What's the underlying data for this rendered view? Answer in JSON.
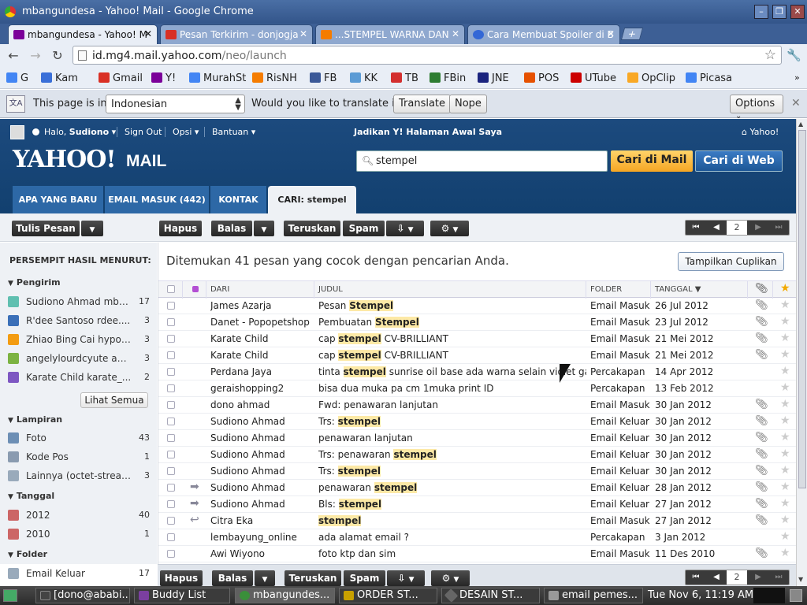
{
  "window": {
    "title": "mbangundesa - Yahoo! Mail - Google Chrome"
  },
  "tabs": [
    {
      "label": "mbangundesa - Yahoo! M",
      "color": "#7b0099",
      "active": true
    },
    {
      "label": "Pesan Terkirim - donjogja",
      "color": "#d93025"
    },
    {
      "label": "...STEMPEL WARNA DAN",
      "color": "#f57c00"
    },
    {
      "label": "Cara Membuat Spoiler di B",
      "color": "#3367d6"
    }
  ],
  "omnibox": {
    "host": "id.mg4.mail.yahoo.com",
    "path": "/neo/launch"
  },
  "bookmarks": [
    {
      "label": "G",
      "color": "#4285f4"
    },
    {
      "label": "Kam",
      "color": "#3a6fd8"
    },
    {
      "label": "Gmail",
      "color": "#d93025"
    },
    {
      "label": "Y!",
      "color": "#7b0099"
    },
    {
      "label": "MurahSt",
      "color": "#4285f4"
    },
    {
      "label": "RisNH",
      "color": "#f57c00"
    },
    {
      "label": "FB",
      "color": "#3b5998"
    },
    {
      "label": "KK",
      "color": "#5b9bd5"
    },
    {
      "label": "TB",
      "color": "#d32f2f"
    },
    {
      "label": "FBin",
      "color": "#2e7d32"
    },
    {
      "label": "JNE",
      "color": "#1a237e"
    },
    {
      "label": "POS",
      "color": "#e65100"
    },
    {
      "label": "UTube",
      "color": "#cc0000"
    },
    {
      "label": "OpClip",
      "color": "#f9a825"
    },
    {
      "label": "Picasa",
      "color": "#4285f4"
    }
  ],
  "translate": {
    "intro": "This page is in",
    "language": "Indonesian",
    "question": "Would you like to translate it?",
    "translate_btn": "Translate",
    "nope_btn": "Nope",
    "options_btn": "Options"
  },
  "header": {
    "greeting_prefix": "Halo,",
    "user": "Sudiono",
    "signout": "Sign Out",
    "opsi": "Opsi",
    "bantuan": "Bantuan",
    "homepage": "Jadikan Y! Halaman Awal Saya",
    "yahoo_link": "Yahoo!",
    "logo": "YAHOO!",
    "logo_mail": "MAIL",
    "search_value": "stempel",
    "search_mail_btn": "Cari di Mail",
    "search_web_btn": "Cari di Web"
  },
  "navtabs": [
    {
      "label": "APA YANG BARU"
    },
    {
      "label": "EMAIL MASUK (442)"
    },
    {
      "label": "KONTAK"
    },
    {
      "label": "CARI: stempel",
      "active": true
    }
  ],
  "actions": {
    "compose": "Tulis Pesan",
    "delete": "Hapus",
    "reply": "Balas",
    "forward": "Teruskan",
    "spam": "Spam",
    "page": "2"
  },
  "sidebar": {
    "heading": "PERSEMPIT HASIL MENURUT:",
    "senders_title": "Pengirim",
    "senders": [
      {
        "name": "Sudiono Ahmad mba...",
        "count": "17",
        "color": "#5fbfb0"
      },
      {
        "name": "R'dee Santoso rdee....",
        "count": "3",
        "color": "#3a6fb8"
      },
      {
        "name": "Zhiao Bing Cai hypot...",
        "count": "3",
        "color": "#f39c12"
      },
      {
        "name": "angelylourdcyute ang...",
        "count": "3",
        "color": "#7cb342"
      },
      {
        "name": "Karate Child karate_...",
        "count": "2",
        "color": "#7e57c2"
      }
    ],
    "see_all": "Lihat Semua",
    "attachments_title": "Lampiran",
    "attachments": [
      {
        "name": "Foto",
        "count": "43",
        "color": "#6d8fb5"
      },
      {
        "name": "Kode Pos",
        "count": "1",
        "color": "#8a9bb0"
      },
      {
        "name": "Lainnya (octet-stream)",
        "count": "3",
        "color": "#9ab"
      }
    ],
    "date_title": "Tanggal",
    "dates": [
      {
        "name": "2012",
        "count": "40",
        "color": "#c66"
      },
      {
        "name": "2010",
        "count": "1",
        "color": "#c66"
      }
    ],
    "folder_title": "Folder",
    "folders": [
      {
        "name": "Email Keluar",
        "count": "17",
        "color": "#9ab"
      }
    ]
  },
  "results": {
    "message": "Ditemukan 41 pesan yang cocok dengan pencarian Anda.",
    "preview_btn": "Tampilkan Cuplikan",
    "columns": {
      "from": "DARI",
      "subject": "JUDUL",
      "folder": "FOLDER",
      "date": "TANGGAL"
    },
    "rows": [
      {
        "from": "James Azarja",
        "pre": "Pesan ",
        "hl": "Stempel",
        "post": "",
        "folder": "Email Masuk",
        "date": "26 Jul 2012",
        "clip": true,
        "act": ""
      },
      {
        "from": "Danet - Popopetshop",
        "pre": "Pembuatan ",
        "hl": "Stempel",
        "post": "",
        "folder": "Email Masuk",
        "date": "23 Jul 2012",
        "clip": true,
        "act": ""
      },
      {
        "from": "Karate Child",
        "pre": "cap ",
        "hl": "stempel",
        "post": " CV-BRILLIANT",
        "folder": "Email Masuk",
        "date": "21 Mei 2012",
        "clip": true,
        "act": ""
      },
      {
        "from": "Karate Child",
        "pre": "cap ",
        "hl": "stempel",
        "post": " CV-BRILLIANT",
        "folder": "Email Masuk",
        "date": "21 Mei 2012",
        "clip": true,
        "act": ""
      },
      {
        "from": "Perdana Jaya",
        "pre": "tinta ",
        "hl": "stempel",
        "post": " sunrise oil base ada warna selain violet gak bos",
        "folder": "Percakapan",
        "date": "14 Apr 2012",
        "clip": false,
        "act": ""
      },
      {
        "from": "geraishopping2",
        "pre": "bisa dua muka pa cm 1muka print ID",
        "hl": "",
        "post": "",
        "folder": "Percakapan",
        "date": "13 Feb 2012",
        "clip": false,
        "act": ""
      },
      {
        "from": "dono ahmad",
        "pre": "Fwd: penawaran lanjutan",
        "hl": "",
        "post": "",
        "folder": "Email Masuk",
        "date": "30 Jan 2012",
        "clip": true,
        "act": ""
      },
      {
        "from": "Sudiono Ahmad",
        "pre": "Trs: ",
        "hl": "stempel",
        "post": "",
        "folder": "Email Keluar",
        "date": "30 Jan 2012",
        "clip": true,
        "act": ""
      },
      {
        "from": "Sudiono Ahmad",
        "pre": "penawaran lanjutan",
        "hl": "",
        "post": "",
        "folder": "Email Keluar",
        "date": "30 Jan 2012",
        "clip": true,
        "act": ""
      },
      {
        "from": "Sudiono Ahmad",
        "pre": "Trs: penawaran ",
        "hl": "stempel",
        "post": "",
        "folder": "Email Keluar",
        "date": "30 Jan 2012",
        "clip": true,
        "act": ""
      },
      {
        "from": "Sudiono Ahmad",
        "pre": "Trs: ",
        "hl": "stempel",
        "post": "",
        "folder": "Email Keluar",
        "date": "30 Jan 2012",
        "clip": true,
        "act": ""
      },
      {
        "from": "Sudiono Ahmad",
        "pre": "penawaran ",
        "hl": "stempel",
        "post": "",
        "folder": "Email Keluar",
        "date": "28 Jan 2012",
        "clip": true,
        "act": "➡"
      },
      {
        "from": "Sudiono Ahmad",
        "pre": "Bls: ",
        "hl": "stempel",
        "post": "",
        "folder": "Email Keluar",
        "date": "27 Jan 2012",
        "clip": true,
        "act": "➡"
      },
      {
        "from": "Citra Eka",
        "pre": "",
        "hl": "stempel",
        "post": "",
        "folder": "Email Masuk",
        "date": "27 Jan 2012",
        "clip": true,
        "act": "↩"
      },
      {
        "from": "lembayung_online",
        "pre": "ada alamat email ?",
        "hl": "",
        "post": "",
        "folder": "Percakapan",
        "date": "3 Jan 2012",
        "clip": false,
        "act": ""
      },
      {
        "from": "Awi Wiyono",
        "pre": "foto ktp dan sim",
        "hl": "",
        "post": "",
        "folder": "Email Masuk",
        "date": "11 Des 2010",
        "clip": true,
        "act": ""
      }
    ]
  },
  "taskbar": {
    "items": [
      {
        "label": "[dono@ababi...",
        "color": "#444"
      },
      {
        "label": "Buddy List",
        "color": "#7b3fa0"
      },
      {
        "label": "mbangundes...",
        "color": "#3a8f3a"
      },
      {
        "label": "ORDER ST...",
        "color": "#c8a000"
      },
      {
        "label": "DESAIN ST...",
        "color": "#666"
      },
      {
        "label": "email pemes...",
        "color": "#999"
      }
    ],
    "clock": "Tue Nov  6, 11:19 AM"
  }
}
